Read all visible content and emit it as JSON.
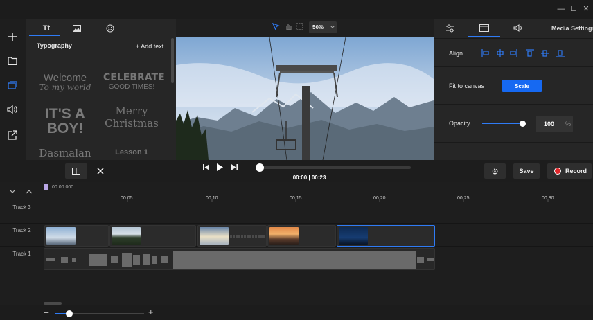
{
  "window": {
    "minimize": "—",
    "maximize": "☐",
    "close": "✕"
  },
  "sidebar": [
    {
      "name": "add",
      "glyph": "+"
    },
    {
      "name": "folder",
      "glyph": "folder"
    },
    {
      "name": "layers",
      "glyph": "layers"
    },
    {
      "name": "audio",
      "glyph": "speaker"
    },
    {
      "name": "export",
      "glyph": "export"
    }
  ],
  "left_panel": {
    "tabs": [
      "Tt",
      "image",
      "sticker"
    ],
    "title": "Typography",
    "add_text": "+ Add text",
    "templates": [
      {
        "line1": "Welcome",
        "line2": "To my world"
      },
      {
        "line1": "CELEBRATE",
        "line2": "GOOD TIMES!"
      },
      {
        "line1": "IT'S A",
        "line2": "BOY!"
      },
      {
        "line1": "Merry",
        "line2": "Christmas"
      },
      {
        "line1": "Dasmalan",
        "line2": ""
      },
      {
        "line1": "Lesson 1",
        "line2": ""
      }
    ]
  },
  "preview": {
    "zoom": "50%"
  },
  "right_panel": {
    "tabs": [
      "adjust",
      "display",
      "audio",
      "Media Settings"
    ],
    "media_settings_label": "Media Settings",
    "align_label": "Align",
    "fit_label": "Fit to canvas",
    "scale_label": "Scale",
    "opacity_label": "Opacity",
    "opacity_value": "100",
    "opacity_unit": "%",
    "opacity_level": 1.0
  },
  "controls": {
    "save": "Save",
    "record": "Record",
    "timecode": "00:00 | 00:23",
    "position": 0.0
  },
  "timeline": {
    "start": "00:00.000",
    "ticks": [
      "00:05",
      "00:10",
      "00:15",
      "00:20",
      "00:25",
      "00:30"
    ],
    "tracks": [
      "Track 3",
      "Track 2",
      "Track 1"
    ]
  },
  "colors": {
    "accent": "#2f7bf5",
    "record": "#e0262a"
  }
}
